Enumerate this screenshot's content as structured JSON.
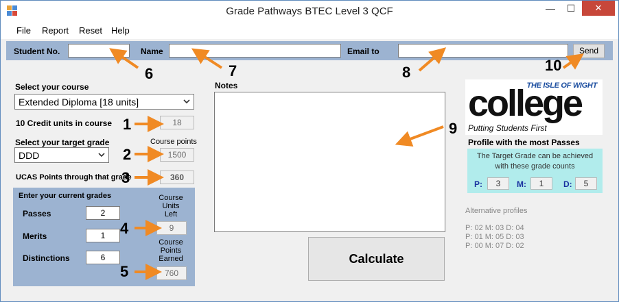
{
  "window": {
    "title": "Grade Pathways BTEC Level 3 QCF",
    "icons": {
      "app": "app-icon",
      "minimize": "minimize-icon",
      "maximize": "maximize-icon",
      "close": "close-icon"
    }
  },
  "menu": [
    "File",
    "Report",
    "Reset",
    "Help"
  ],
  "student_bar": {
    "student_no_label": "Student No.",
    "student_no_value": "",
    "name_label": "Name",
    "name_value": "",
    "email_label": "Email to",
    "email_value": "",
    "send_label": "Send"
  },
  "course": {
    "select_label": "Select your course",
    "selected": "Extended Diploma [18 units]",
    "credit_units_label": "10 Credit units in course",
    "credit_units_value": "18",
    "target_label": "Select your target grade",
    "target_selected": "DDD",
    "course_points_label": "Course points",
    "course_points_value": "1500",
    "ucas_label": "UCAS Points through that grade",
    "ucas_value": "360"
  },
  "current_grades": {
    "heading": "Enter your current grades",
    "passes_label": "Passes",
    "passes_value": "2",
    "merits_label": "Merits",
    "merits_value": "1",
    "distinctions_label": "Distinctions",
    "distinctions_value": "6",
    "units_left_label": [
      "Course",
      "Units",
      "Left"
    ],
    "units_left_value": "9",
    "points_earned_label": [
      "Course",
      "Points",
      "Earned"
    ],
    "points_earned_value": "760"
  },
  "notes": {
    "label": "Notes",
    "value": ""
  },
  "calculate_label": "Calculate",
  "logo": {
    "top": "THE ISLE OF WIGHT",
    "main": "college",
    "sub": "Putting Students First"
  },
  "profile": {
    "heading": "Profile with the most Passes",
    "text_line1": "The Target Grade can be achieved",
    "text_line2": "with these grade counts",
    "p_label": "P:",
    "p_value": "3",
    "m_label": "M:",
    "m_value": "1",
    "d_label": "D:",
    "d_value": "5"
  },
  "alternatives": {
    "heading": "Alternative profiles",
    "lines": [
      "P: 02  M: 03  D: 04",
      "P: 01  M: 05  D: 03",
      "P: 00  M: 07  D: 02"
    ]
  },
  "annotations": [
    "1",
    "2",
    "3",
    "4",
    "5",
    "6",
    "7",
    "8",
    "9",
    "10"
  ],
  "colors": {
    "arrow": "#f08a24",
    "panel": "#9cb3d1",
    "profile_bg": "#b1ecec",
    "accent_text": "#1a32a0"
  }
}
